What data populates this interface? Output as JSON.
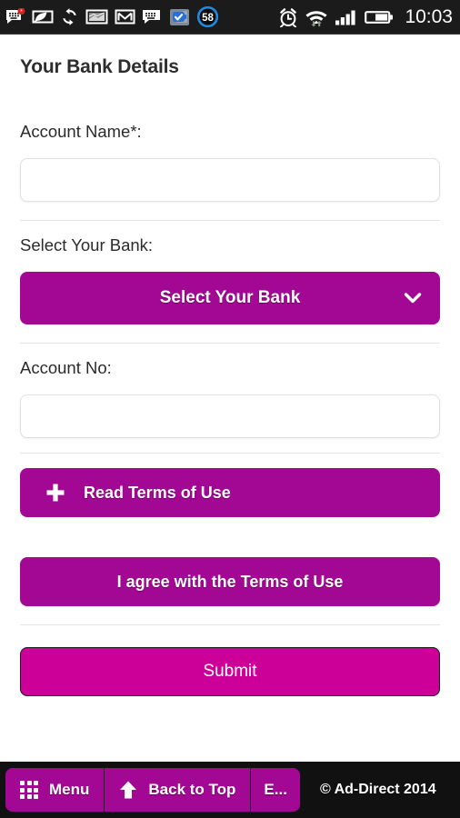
{
  "status_bar": {
    "clock": "10:03",
    "left_icons": [
      {
        "name": "messaging-icon",
        "glyph": "message-bubble-keyboard-star"
      },
      {
        "name": "leaf-battery-icon",
        "glyph": "leaf-in-frame"
      },
      {
        "name": "sync-icon",
        "glyph": "circular-arrows"
      },
      {
        "name": "screenshot-icon",
        "glyph": "picture-frame"
      },
      {
        "name": "gmail-icon",
        "glyph": "envelope-m"
      },
      {
        "name": "sms-icon",
        "glyph": "message-bubble-keyboard"
      },
      {
        "name": "battery-doctor-icon",
        "glyph": "battery-with-check"
      },
      {
        "name": "notification-count-icon",
        "glyph": "circle-58",
        "badge": "58"
      }
    ],
    "right_icons": [
      {
        "name": "alarm-clock-icon",
        "glyph": "alarm-clock"
      },
      {
        "name": "wifi-icon",
        "glyph": "wifi-with-updown-arrows"
      },
      {
        "name": "signal-icon",
        "glyph": "signal-bars-4"
      },
      {
        "name": "battery-icon",
        "glyph": "battery-half"
      }
    ]
  },
  "page": {
    "title": "Your Bank Details"
  },
  "form": {
    "account_name": {
      "label": "Account Name*:",
      "value": "",
      "placeholder": ""
    },
    "bank_select": {
      "label": "Select Your Bank:",
      "selected": "Select Your Bank",
      "chevron": "chevron-down-icon"
    },
    "account_no": {
      "label": "Account No:",
      "value": "",
      "placeholder": ""
    },
    "read_terms_label": "Read Terms of Use",
    "agree_terms_label": "I agree with the Terms of Use",
    "submit_label": "Submit"
  },
  "bottom_bar": {
    "menu_label": "Menu",
    "back_to_top_label": "Back to Top",
    "extra_label": "E...",
    "copyright": "© Ad-Direct 2014"
  },
  "colors": {
    "brand_magenta": "#a30894",
    "submit_magenta": "#cc0099",
    "status_bar_bg": "#1b1b1b",
    "bottom_bar_bg": "#111111",
    "divider": "#e4e4e4",
    "text": "#2b2b2b"
  }
}
